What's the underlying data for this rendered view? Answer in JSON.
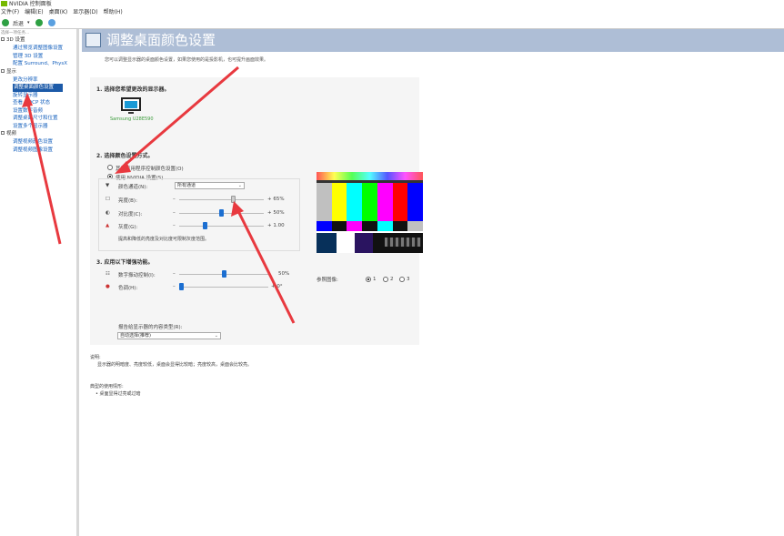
{
  "window": {
    "title": "NVIDIA 控制面板"
  },
  "menu": [
    "文件(F)",
    "编辑(E)",
    "桌面(K)",
    "显示器(D)",
    "帮助(H)"
  ],
  "toolbar": {
    "back_label": "后退"
  },
  "sidebar": {
    "hint": "选择一项任务...",
    "categories": [
      {
        "label": "3D 设置",
        "items": [
          "通过预览调整图像设置",
          "管理 3D 设置",
          "配置 Surround、PhysX"
        ]
      },
      {
        "label": "显示",
        "items": [
          "更改分辨率",
          "调整桌面颜色设置",
          "旋转显示器",
          "查看 HDCP 状态",
          "设置数字音频",
          "调整桌面尺寸和位置",
          "设置多个显示器"
        ]
      },
      {
        "label": "视频",
        "items": [
          "调整视频颜色设置",
          "调整视频图像设置"
        ]
      }
    ],
    "selected": "调整桌面颜色设置"
  },
  "page": {
    "title": "调整桌面颜色设置",
    "description": "您可以调整显示器的桌面颜色设置，如果您使用的是投影机，也可提升画面效果。"
  },
  "section1": {
    "heading": "1. 选择您希望更改的显示器。",
    "monitor_name": "Samsung U28E590"
  },
  "section2": {
    "heading": "2. 选择颜色设置方式。",
    "option_app": "其它应用程序控制颜色设置(O)",
    "option_nvidia": "使用 NVIDIA 设置(S)",
    "channel_label": "颜色通道(N):",
    "channel_value": "所有通道",
    "brightness_label": "亮度(B):",
    "brightness_value": "+ 65%",
    "brightness_level": 0.65,
    "contrast_label": "对比度(C):",
    "contrast_value": "+ 50%",
    "contrast_level": 0.5,
    "gamma_label": "灰度(G):",
    "gamma_value": "+ 1.00",
    "gamma_level": 0.3,
    "hint": "提高和降低的亮度及对比度可限制灰度范围。"
  },
  "section3": {
    "heading": "3. 应用以下增强功能。",
    "vibrance_label": "数字振动控制(I):",
    "vibrance_value": "50%",
    "vibrance_level": 0.5,
    "hue_label": "色调(H):",
    "hue_value": "+ 0°",
    "hue_level": 0.0,
    "ref_label": "参照图像:",
    "ref_options": [
      "1",
      "2",
      "3"
    ],
    "content_type_label": "报告给显示器的内容类型(R):",
    "content_type_value": "自动选择(推荐)"
  },
  "notes": {
    "desc_heading": "说明:",
    "desc_text": "显示器的明暗度、亮度较低，桌面会显得比较暗；亮度较高，桌面会比较亮。",
    "usage_heading": "典型的使用情形:",
    "usage_item": "• 桌面显得过亮或过暗"
  },
  "colors": {
    "banner": "#aebed6",
    "selection": "#1c5aa8",
    "link": "#1560bd",
    "arrow": "#e8393f",
    "nvidia": "#76b900"
  }
}
